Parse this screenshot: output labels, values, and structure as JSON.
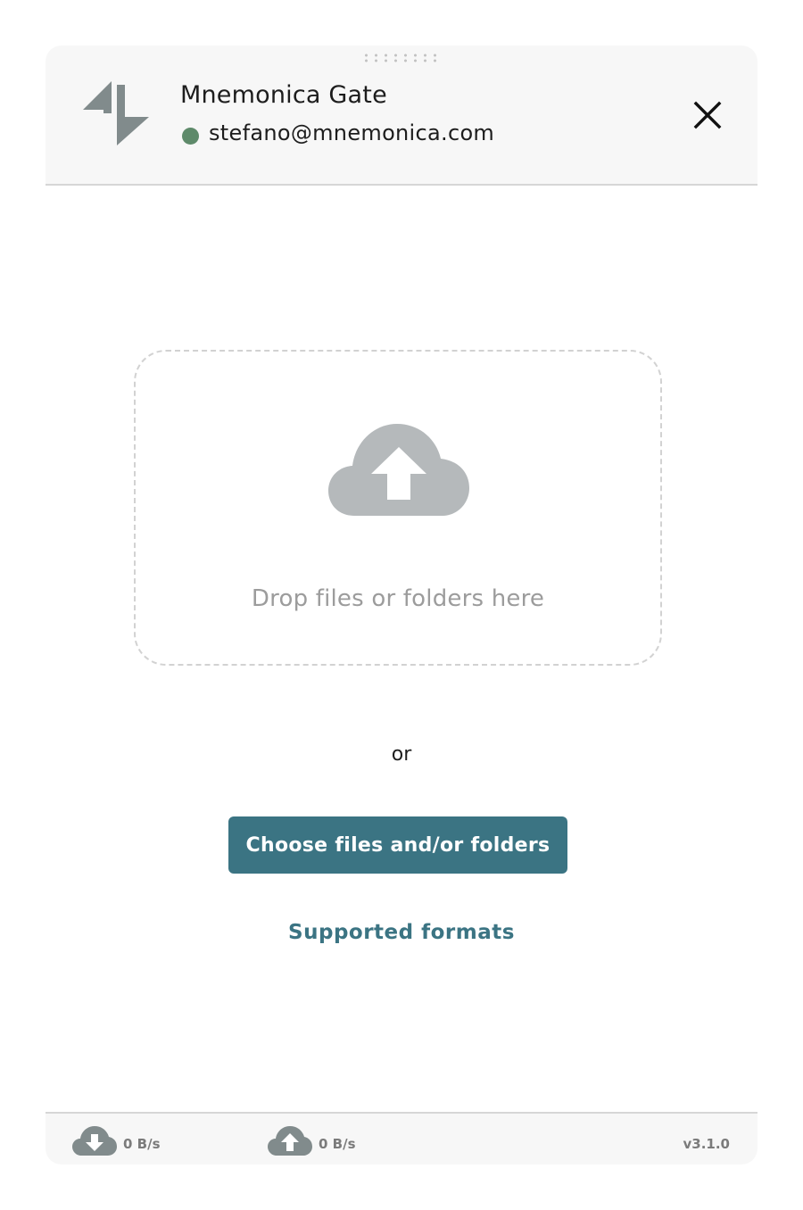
{
  "header": {
    "title": "Mnemonica Gate",
    "user_email": "stefano@mnemonica.com",
    "status_color": "#5e8a6a",
    "logo_icon": "mnemonica-logo-icon",
    "close_icon": "close-icon"
  },
  "dropzone": {
    "icon": "cloud-upload-icon",
    "text": "Drop files or folders here"
  },
  "main": {
    "or_text": "or",
    "choose_label": "Choose files and/or folders",
    "formats_link": "Supported formats"
  },
  "footer": {
    "download_icon": "cloud-download-icon",
    "download_rate": "0 B/s",
    "upload_icon": "cloud-upload-icon",
    "upload_rate": "0 B/s",
    "version": "v3.1.0"
  },
  "colors": {
    "accent": "#3b7483",
    "icon_gray": "#b5b9bb",
    "logo_gray": "#818b8c"
  }
}
